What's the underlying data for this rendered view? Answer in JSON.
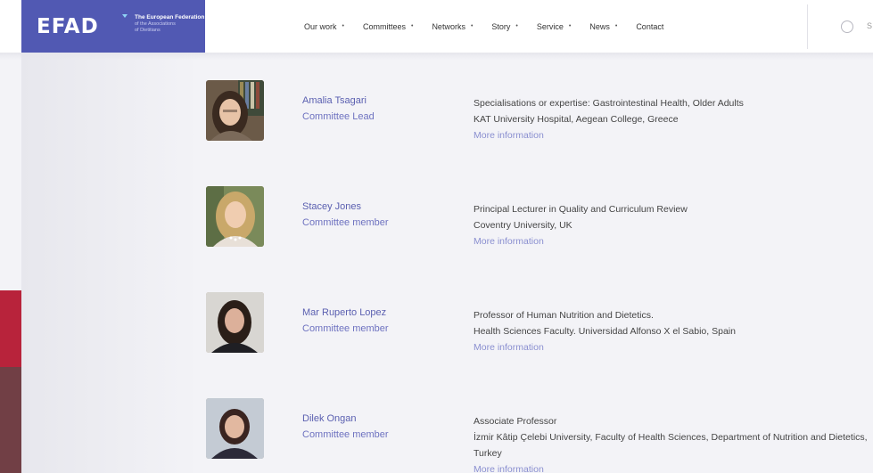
{
  "logo": {
    "mark": "EFAD",
    "line1": "The European Federation",
    "line2": "of the Associations",
    "line3": "of Dietitians"
  },
  "nav": {
    "items": [
      {
        "label": "Our work",
        "has_menu": true
      },
      {
        "label": "Committees",
        "has_menu": true
      },
      {
        "label": "Networks",
        "has_menu": true
      },
      {
        "label": "Story",
        "has_menu": true
      },
      {
        "label": "Service",
        "has_menu": true
      },
      {
        "label": "News",
        "has_menu": true
      },
      {
        "label": "Contact",
        "has_menu": false
      }
    ],
    "search_cut": "S"
  },
  "members": [
    {
      "name": "Amalia Tsagari",
      "role": "Committee Lead",
      "line1": "Specialisations or expertise: Gastrointestinal Health, Older Adults",
      "line2": "KAT University Hospital, Aegean College, Greece",
      "more": "More information"
    },
    {
      "name": "Stacey Jones",
      "role": "Committee member",
      "line1": "Principal Lecturer in Quality and Curriculum Review",
      "line2": "Coventry University, UK",
      "more": "More information"
    },
    {
      "name": "Mar Ruperto Lopez",
      "role": "Committee member",
      "line1": "Professor of Human Nutrition and Dietetics.",
      "line2": "Health Sciences Faculty. Universidad Alfonso X el Sabio, Spain",
      "more": "More information"
    },
    {
      "name": "Dilek Ongan",
      "role": "Committee member",
      "line1": "Associate Professor",
      "line2": "İzmir Kâtip Çelebi University, Faculty of Health Sciences, Department of Nutrition and Dietetics, Turkey",
      "more": "More information"
    }
  ],
  "colors": {
    "brand": "#5159b3",
    "name": "#5a5fb0",
    "link": "#8a8fd0",
    "strip_red": "#b8233b",
    "strip_dark": "#713f45"
  }
}
